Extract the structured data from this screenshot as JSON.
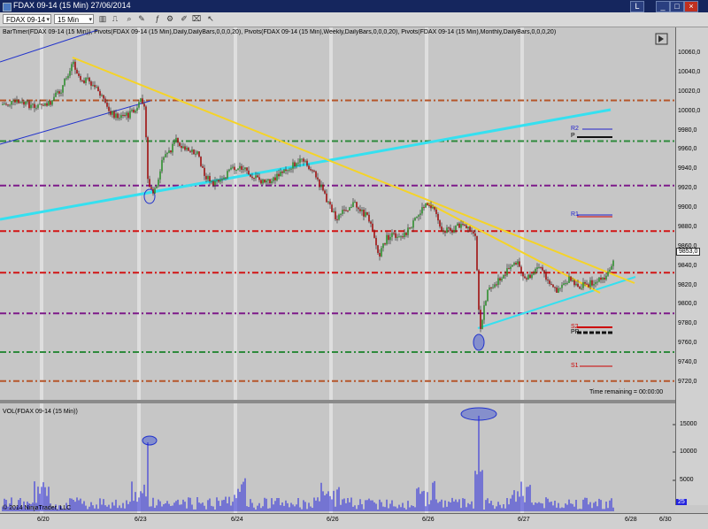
{
  "window": {
    "title": "FDAX 09-14 (15 Min)  27/06/2014",
    "buttons": [
      "_",
      "□",
      "×"
    ],
    "toolbar_extra_label": "L"
  },
  "toolbar": {
    "instrument": "FDAX 09-14",
    "interval": "15 Min"
  },
  "price_panel": {
    "indicator_label": "BarTimer(FDAX 09-14 (15 Min)), Pivots(FDAX 09-14 (15 Min),Daily,DailyBars,0,0,0,20), Pivots(FDAX 09-14 (15 Min),Weekly,DailyBars,0,0,0,20), Pivots(FDAX 09-14 (15 Min),Monthly,DailyBars,0,0,0,20)",
    "y_ticks": [
      "10060,0",
      "10040,0",
      "10020,0",
      "10000,0",
      "9980,0",
      "9960,0",
      "9940,0",
      "9920,0",
      "9900,0",
      "9880,0",
      "9860,0",
      "9840,0",
      "9820,0",
      "9800,0",
      "9780,0",
      "9760,0",
      "9740,0",
      "9720,0"
    ],
    "current_price": "9853,0",
    "time_remaining": "Time remaining = 00:00:00",
    "pivot_labels": {
      "r2": "R2",
      "pp_top": "P",
      "r1": "R1",
      "s2": "S2",
      "pp_low": "PP",
      "s1": "S1"
    }
  },
  "volume_panel": {
    "label": "VOL(FDAX 09-14 (15 Min))",
    "y_ticks": [
      "15000",
      "10000",
      "5000"
    ],
    "current_vol": "25"
  },
  "x_axis": {
    "ticks": [
      "6/20",
      "6/23",
      "6/24",
      "6/26",
      "6/26",
      "6/27",
      "6/28",
      "6/30"
    ]
  },
  "copyright": "© 2014 NinjaTrader, LLC",
  "colors": {
    "trend_yellow": "#f5d327",
    "trend_cyan": "#35e0f0",
    "up_candle": "#2f8f2f",
    "down_candle": "#a01010",
    "volume_bar": "#2222dd"
  }
}
